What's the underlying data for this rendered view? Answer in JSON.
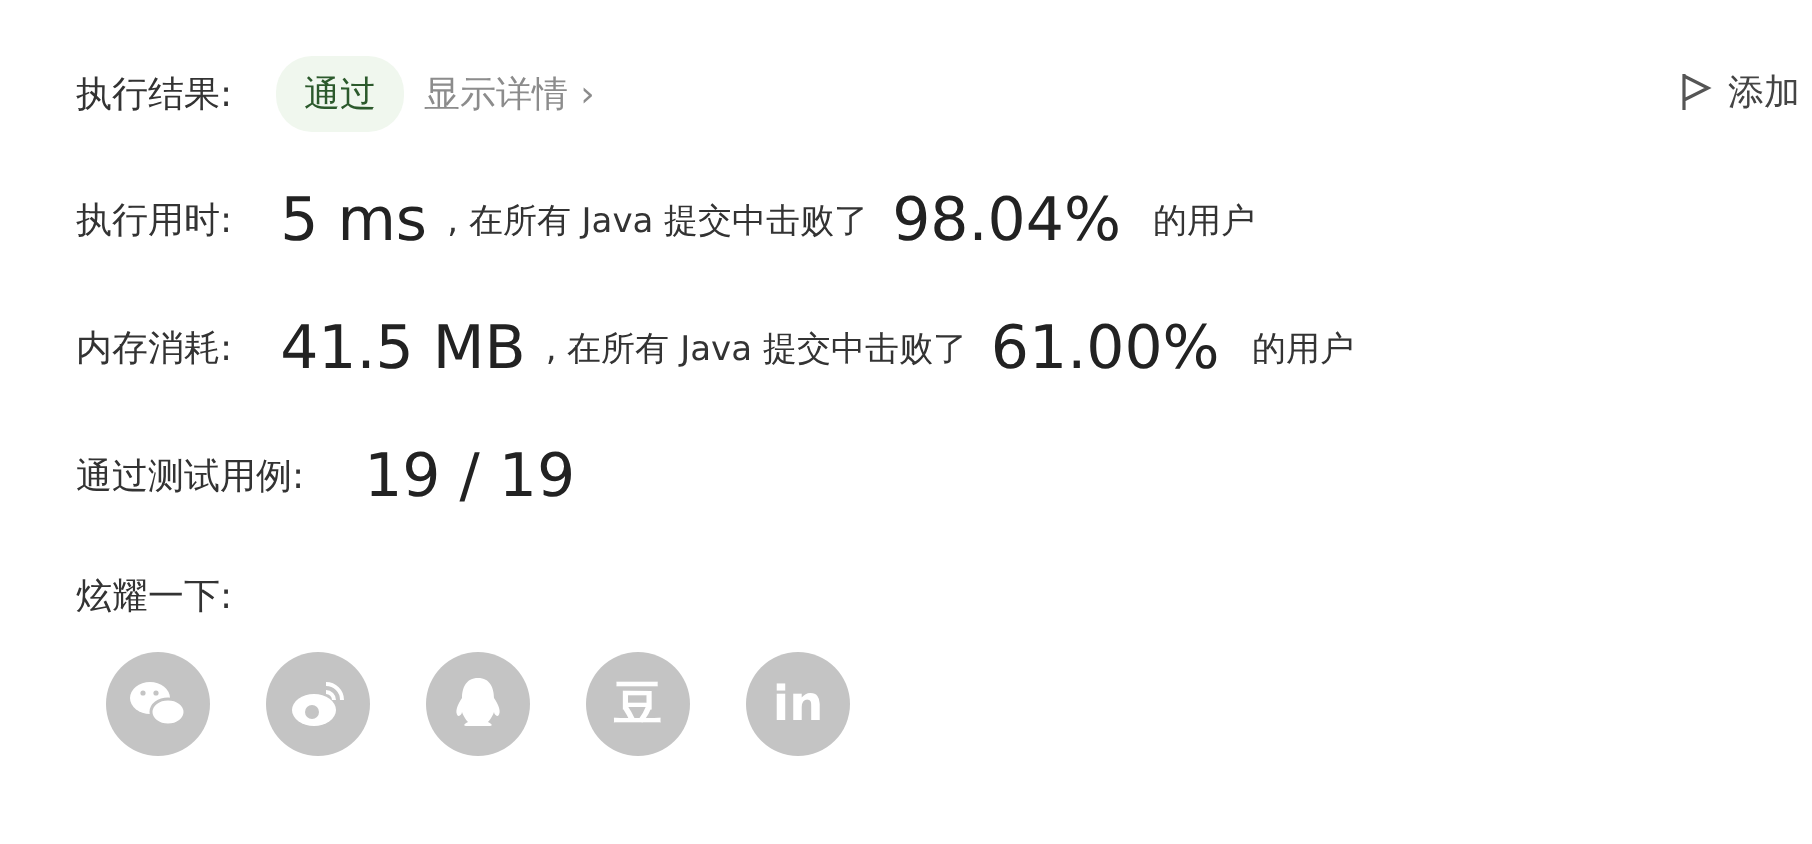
{
  "result": {
    "label": "执行结果:",
    "status": "通过",
    "details": "显示详情",
    "details_arrow": "›",
    "action": "添加"
  },
  "stats": [
    {
      "label": "执行用时:",
      "value": "5 ms",
      "text": ", 在所有 Java 提交中击败了",
      "percent": "98.04%",
      "suffix": "的用户"
    },
    {
      "label": "内存消耗:",
      "value": "41.5 MB",
      "text": ", 在所有 Java 提交中击败了",
      "percent": "61.00%",
      "suffix": "的用户"
    }
  ],
  "tests": {
    "label": "通过测试用例:",
    "value": "19 / 19"
  },
  "share": {
    "label": "炫耀一下:",
    "items": [
      {
        "kind": "wechat"
      },
      {
        "kind": "weibo"
      },
      {
        "kind": "qq"
      },
      {
        "kind": "text",
        "text": "豆"
      },
      {
        "kind": "text",
        "text": "in"
      }
    ]
  }
}
